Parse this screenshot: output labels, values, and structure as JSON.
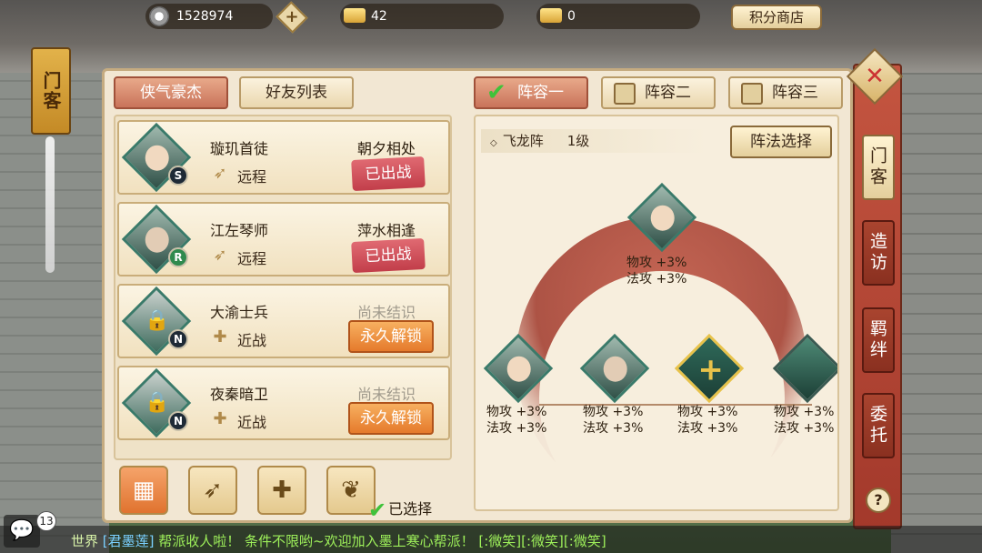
{
  "top": {
    "coins": "1528974",
    "gold": "42",
    "ingots": "0",
    "shop_label": "积分商店",
    "plus_label": "+"
  },
  "banner": {
    "title": "门客"
  },
  "left_tabs": [
    {
      "label": "侠气豪杰",
      "active": true
    },
    {
      "label": "好友列表",
      "active": false
    }
  ],
  "members": [
    {
      "name": "璇玑首徒",
      "type": "远程",
      "status": "朝夕相处",
      "action": "已出战",
      "rank": "S",
      "locked": false
    },
    {
      "name": "江左琴师",
      "type": "远程",
      "status": "萍水相逢",
      "action": "已出战",
      "rank": "R",
      "locked": false
    },
    {
      "name": "大渝士兵",
      "type": "近战",
      "status": "尚未结识",
      "action": "永久解锁",
      "rank": "N",
      "locked": true
    },
    {
      "name": "夜秦暗卫",
      "type": "近战",
      "status": "尚未结识",
      "action": "永久解锁",
      "rank": "N",
      "locked": true
    }
  ],
  "filters": [
    "all",
    "ranged",
    "melee",
    "support"
  ],
  "lineup_tabs": [
    {
      "label": "阵容一",
      "active": true
    },
    {
      "label": "阵容二",
      "active": false
    },
    {
      "label": "阵容三",
      "active": false
    }
  ],
  "formation": {
    "name": "飞龙阵",
    "level": "1级",
    "choose_label": "阵法选择",
    "slots": [
      {
        "line1": "物攻 +3%",
        "line2": "法攻 +3%"
      },
      {
        "line1": "物攻 +3%",
        "line2": "法攻 +3%"
      },
      {
        "line1": "物攻 +3%",
        "line2": "法攻 +3%"
      },
      {
        "line1": "物攻 +3%",
        "line2": "法攻 +3%"
      },
      {
        "line1": "物攻 +3%",
        "line2": "法攻 +3%"
      }
    ],
    "selected_label": "已选择"
  },
  "sidenav": [
    {
      "label": "门客",
      "active": true
    },
    {
      "label": "造访",
      "active": false
    },
    {
      "label": "羁绊",
      "active": false
    },
    {
      "label": "委托",
      "active": false
    }
  ],
  "help_label": "?",
  "chat": {
    "badge": "13",
    "channel": "世界",
    "sender": "[君墨莲]",
    "message": " 帮派收人啦！ 条件不限哟~欢迎加入墨上寒心帮派！ [:微笑][:微笑][:微笑]"
  }
}
